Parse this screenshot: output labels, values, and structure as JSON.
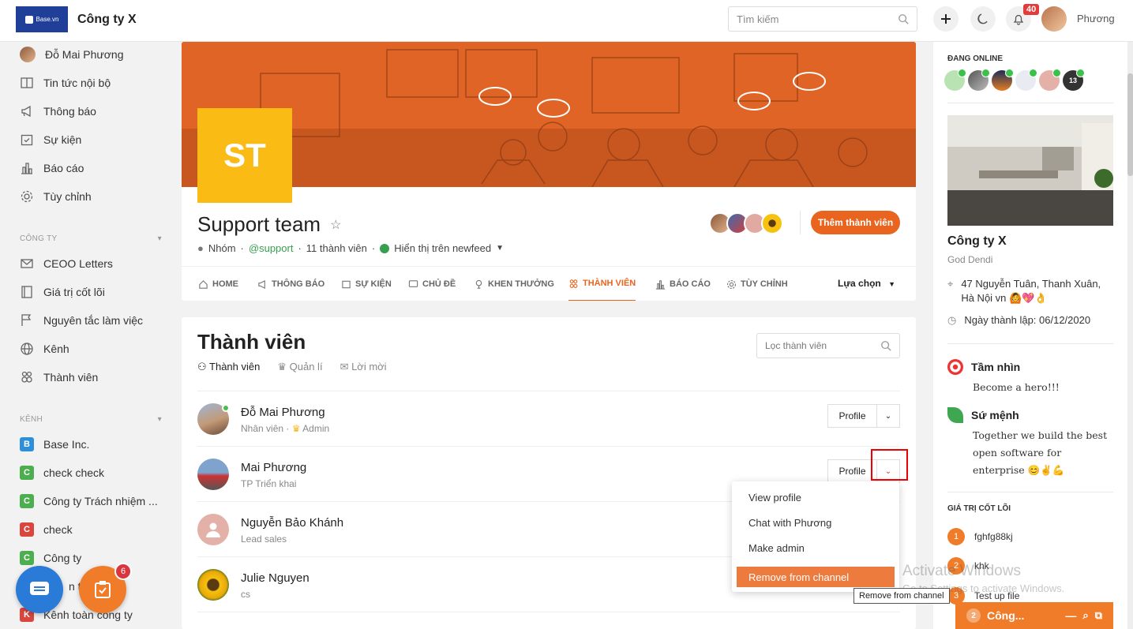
{
  "header": {
    "logo_text": "Base.vn",
    "company": "Công ty X",
    "search_placeholder": "Tìm kiếm",
    "notif_count": "40",
    "user_name": "Phương"
  },
  "sidebar": {
    "top_items": [
      {
        "label": "Đỗ Mai Phương",
        "icon": "user-avatar"
      },
      {
        "label": "Tin tức nội bộ",
        "icon": "newspaper-icon"
      },
      {
        "label": "Thông báo",
        "icon": "megaphone-icon"
      },
      {
        "label": "Sự kiện",
        "icon": "calendar-icon"
      },
      {
        "label": "Báo cáo",
        "icon": "report-icon"
      },
      {
        "label": "Tùy chỉnh",
        "icon": "gear-icon"
      }
    ],
    "company_section": "CÔNG TY",
    "company_items": [
      {
        "label": "CEOO Letters",
        "icon": "mail-icon"
      },
      {
        "label": "Giá trị cốt lõi",
        "icon": "book-icon"
      },
      {
        "label": "Nguyên tắc làm việc",
        "icon": "flag-icon"
      },
      {
        "label": "Kênh",
        "icon": "globe-icon"
      },
      {
        "label": "Thành viên",
        "icon": "members-icon"
      }
    ],
    "channel_section": "KÊNH",
    "channels": [
      {
        "letter": "B",
        "label": "Base Inc.",
        "color": "#2d8fd9"
      },
      {
        "letter": "C",
        "label": "check check",
        "color": "#4cae4f"
      },
      {
        "letter": "C",
        "label": "Công ty Trách nhiệm ...",
        "color": "#4cae4f"
      },
      {
        "letter": "C",
        "label": "check",
        "color": "#d9463e"
      },
      {
        "letter": "C",
        "label": "Công ty",
        "color": "#4cae4f"
      },
      {
        "letter": "",
        "label": "n te",
        "color": "#4cae4f"
      },
      {
        "letter": "K",
        "label": "Kênh toàn công ty",
        "color": "#d9463e"
      }
    ],
    "task_count": "6"
  },
  "group": {
    "initials": "ST",
    "title": "Support team",
    "type": "Nhóm",
    "handle": "@support",
    "members_count": "11 thành viên",
    "visibility": "Hiển thị trên newfeed",
    "add_member_label": "Thêm thành viên",
    "tabs": [
      {
        "label": "HOME",
        "icon": "home-icon"
      },
      {
        "label": "THÔNG BÁO",
        "icon": "megaphone-icon"
      },
      {
        "label": "SỰ KIỆN",
        "icon": "calendar-icon"
      },
      {
        "label": "CHỦ ĐỀ",
        "icon": "chat-icon"
      },
      {
        "label": "KHEN THƯỞNG",
        "icon": "trophy-icon"
      },
      {
        "label": "THÀNH VIÊN",
        "icon": "members-icon"
      },
      {
        "label": "BÁO CÁO",
        "icon": "report-icon"
      },
      {
        "label": "TÙY CHỈNH",
        "icon": "gear-icon"
      }
    ],
    "active_tab": "THÀNH VIÊN",
    "options_label": "Lựa chọn"
  },
  "members": {
    "title": "Thành viên",
    "subtabs": [
      "Thành viên",
      "Quản lí",
      "Lời mời"
    ],
    "filter_placeholder": "Lọc thành viên",
    "rows": [
      {
        "name": "Đỗ Mai Phương",
        "role": "Nhân viên · ",
        "badge": "Admin",
        "button": "Profile",
        "online": true
      },
      {
        "name": "Mai Phương",
        "role": "TP Triển khai",
        "button": "Profile"
      },
      {
        "name": "Nguyễn Bảo Khánh",
        "role": "Lead sales"
      },
      {
        "name": "Julie Nguyen",
        "role": "cs"
      }
    ],
    "dropdown": [
      "View profile",
      "Chat with Phương",
      "Make admin",
      "Remove from channel"
    ],
    "tooltip": "Remove from channel"
  },
  "right": {
    "online_title": "ĐANG ONLINE",
    "online_more": "13",
    "company": "Công ty X",
    "company_sub": "God Dendi",
    "address": "47 Nguyễn Tuân, Thanh Xuân, Hà Nội vn 🙆💖👌",
    "founded": "Ngày thành lập: 06/12/2020",
    "vision_title": "Tầm nhìn",
    "vision_text": "Become a hero!!!",
    "mission_title": "Sứ mệnh",
    "mission_text": "Together we build the best open software for enterprise 😊✌️💪",
    "core_title": "GIÁ TRỊ CỐT LÕI",
    "core_values": [
      {
        "num": "1",
        "label": "fghfg88kj"
      },
      {
        "num": "2",
        "label": "khk"
      },
      {
        "num": "3",
        "label": "Test up file"
      }
    ],
    "chat_count": "2",
    "chat_label": "Công..."
  },
  "watermark": {
    "line1": "Activate Windows",
    "line2": "Go to Settings to activate Windows."
  }
}
